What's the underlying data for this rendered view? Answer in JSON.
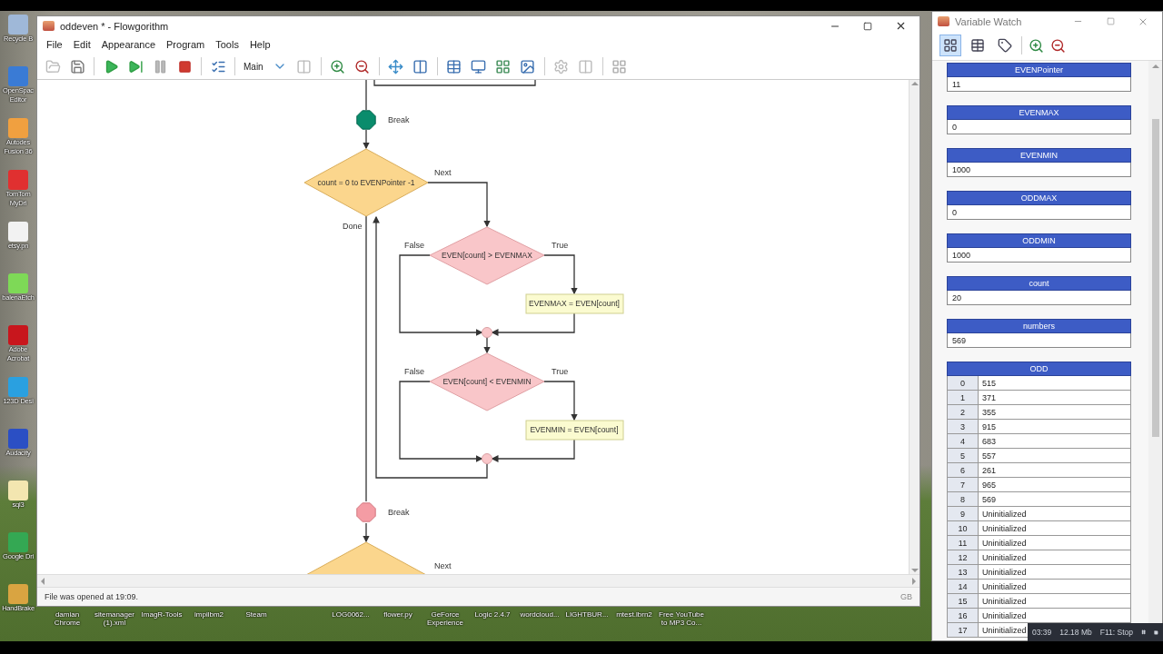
{
  "desktop": {
    "icons": [
      {
        "label": "Recycle B",
        "color": "#9fb8d8"
      },
      {
        "label": "OpenSpac Editor",
        "color": "#3a7bd5"
      },
      {
        "label": "Autodes Fusion 36",
        "color": "#f0a040"
      },
      {
        "label": "TomTom MyDri",
        "color": "#e03030"
      },
      {
        "label": "etsy.pn",
        "color": "#f2f2f2"
      },
      {
        "label": "balenaEtch",
        "color": "#7ed957"
      },
      {
        "label": "Adobe Acrobat",
        "color": "#c8161d"
      },
      {
        "label": "123D Desi",
        "color": "#2aa0e0"
      },
      {
        "label": "Audacity",
        "color": "#2b4fc4"
      },
      {
        "label": "sql3",
        "color": "#f3e6b0"
      },
      {
        "label": "Google Dri",
        "color": "#34a853"
      },
      {
        "label": "HandBrake",
        "color": "#d9a441"
      }
    ],
    "bottom_labels": [
      "damian Chrome",
      "sitemanager (1).xml",
      "ImagR-Tools",
      "impilbm2",
      "Steam",
      "LOG0062...",
      "flower.py",
      "GeForce Experience",
      "Logic 2.4.7",
      "wordcloud...",
      "LIGHTBUR...",
      "mtest.lbrn2",
      "Free YouTube to MP3 Co..."
    ]
  },
  "flowgorithm": {
    "title": "oddeven * - Flowgorithm",
    "menu": [
      "File",
      "Edit",
      "Appearance",
      "Program",
      "Tools",
      "Help"
    ],
    "function_name": "Main",
    "flowchart": {
      "nodes": [
        {
          "kind": "break",
          "label": "Break",
          "active": true
        },
        {
          "kind": "loop",
          "text": "count = 0 to EVENPointer -1",
          "next_label": "Next",
          "done_label": "Done"
        },
        {
          "kind": "decision",
          "text": "EVEN[count] > EVENMAX",
          "false_label": "False",
          "true_label": "True"
        },
        {
          "kind": "assign",
          "text": "EVENMAX = EVEN[count]"
        },
        {
          "kind": "decision",
          "text": "EVEN[count] < EVENMIN",
          "false_label": "False",
          "true_label": "True"
        },
        {
          "kind": "assign",
          "text": "EVENMIN = EVEN[count]"
        },
        {
          "kind": "break",
          "label": "Break",
          "active": false
        },
        {
          "kind": "loop",
          "next_label": "Next"
        }
      ]
    },
    "status": "File was opened at 19:09.",
    "status_right": "GB"
  },
  "variable_watch": {
    "title": "Variable Watch",
    "view_buttons": [
      {
        "kind": "boxes",
        "selected": true
      },
      {
        "kind": "table",
        "selected": false
      },
      {
        "kind": "label",
        "selected": false
      }
    ],
    "variables": [
      {
        "name": "EVENPointer",
        "value": "11"
      },
      {
        "name": "EVENMAX",
        "value": "0"
      },
      {
        "name": "EVENMIN",
        "value": "1000"
      },
      {
        "name": "ODDMAX",
        "value": "0"
      },
      {
        "name": "ODDMIN",
        "value": "1000"
      },
      {
        "name": "count",
        "value": "20"
      },
      {
        "name": "numbers",
        "value": "569"
      }
    ],
    "array": {
      "name": "ODD",
      "rows": [
        {
          "index": "0",
          "value": "515"
        },
        {
          "index": "1",
          "value": "371"
        },
        {
          "index": "2",
          "value": "355"
        },
        {
          "index": "3",
          "value": "915"
        },
        {
          "index": "4",
          "value": "683"
        },
        {
          "index": "5",
          "value": "557"
        },
        {
          "index": "6",
          "value": "261"
        },
        {
          "index": "7",
          "value": "965"
        },
        {
          "index": "8",
          "value": "569"
        },
        {
          "index": "9",
          "value": "Uninitialized"
        },
        {
          "index": "10",
          "value": "Uninitialized"
        },
        {
          "index": "11",
          "value": "Uninitialized"
        },
        {
          "index": "12",
          "value": "Uninitialized"
        },
        {
          "index": "13",
          "value": "Uninitialized"
        },
        {
          "index": "14",
          "value": "Uninitialized"
        },
        {
          "index": "15",
          "value": "Uninitialized"
        },
        {
          "index": "16",
          "value": "Uninitialized"
        },
        {
          "index": "17",
          "value": "Uninitialized"
        }
      ]
    }
  },
  "recorder": {
    "time": "03:39",
    "size": "12.18 Mb",
    "hint": "F11: Stop"
  }
}
